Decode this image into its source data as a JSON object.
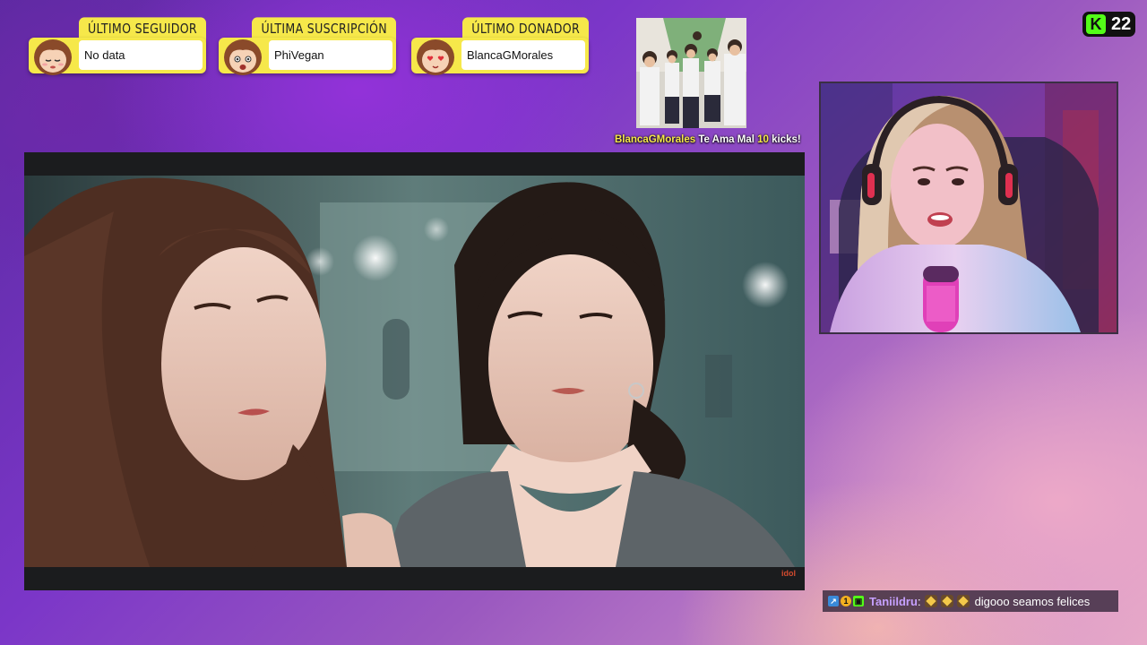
{
  "alerts": [
    {
      "title": "ÚLTIMO SEGUIDOR",
      "value": "No data",
      "avatar_icon": "girl-avatar-sleepy"
    },
    {
      "title": "ÚLTIMA SUSCRIPCIÓN",
      "value": "PhiVegan",
      "avatar_icon": "girl-avatar-surprised"
    },
    {
      "title": "ÚLTIMO DONADOR",
      "value": "BlancaGMorales",
      "avatar_icon": "girl-avatar-love"
    }
  ],
  "kick": {
    "count": "22",
    "logo": "K"
  },
  "gift": {
    "user": "BlancaGMorales",
    "text": " Te Ama Mal ",
    "amount": "10",
    "unit": " kicks!"
  },
  "video": {
    "watermark": "idol"
  },
  "chat": {
    "username": "Taniildru",
    "separator": " :",
    "message": "digooo seamos felices"
  },
  "colors": {
    "accent": "#f6e84a",
    "kick_green": "#53fc18",
    "username": "#c6a0ff"
  }
}
